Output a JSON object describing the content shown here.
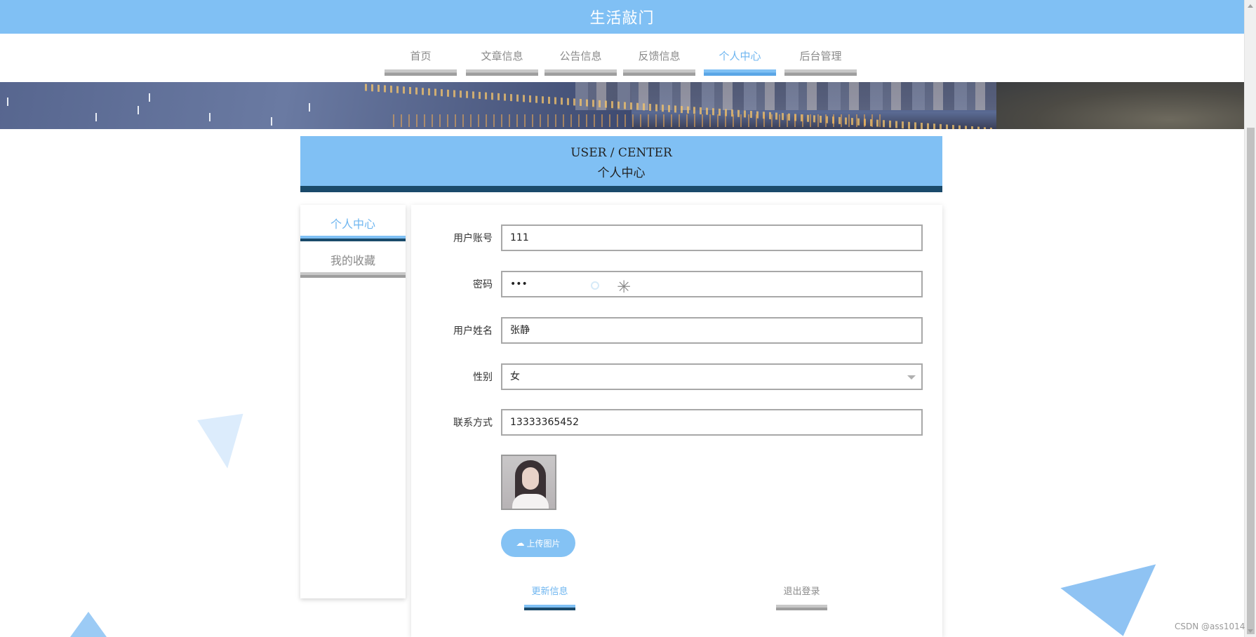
{
  "header": {
    "title": "生活敲门"
  },
  "nav": {
    "items": [
      {
        "label": "首页"
      },
      {
        "label": "文章信息"
      },
      {
        "label": "公告信息"
      },
      {
        "label": "反馈信息"
      },
      {
        "label": "个人中心",
        "active": true
      },
      {
        "label": "后台管理"
      }
    ]
  },
  "section": {
    "title_en": "USER / CENTER",
    "title_cn": "个人中心"
  },
  "sidebar": {
    "items": [
      {
        "label": "个人中心",
        "active": true
      },
      {
        "label": "我的收藏"
      }
    ]
  },
  "form": {
    "account": {
      "label": "用户账号",
      "value": "111"
    },
    "password": {
      "label": "密码",
      "value": "•••"
    },
    "name": {
      "label": "用户姓名",
      "value": "张静"
    },
    "gender": {
      "label": "性别",
      "value": "女"
    },
    "phone": {
      "label": "联系方式",
      "value": "13333365452"
    },
    "upload_label": "上传图片",
    "update_label": "更新信息",
    "logout_label": "退出登录"
  },
  "footer": {
    "watermark": "CSDN @ass1014"
  },
  "colors": {
    "accent": "#80c0f4",
    "accent_dark": "#1a4a6a",
    "inactive": "#9e9e9e"
  },
  "icons": {
    "upload": "cloud-upload-icon",
    "select": "chevron-down-icon",
    "spinner": "loading-spinner-icon"
  }
}
